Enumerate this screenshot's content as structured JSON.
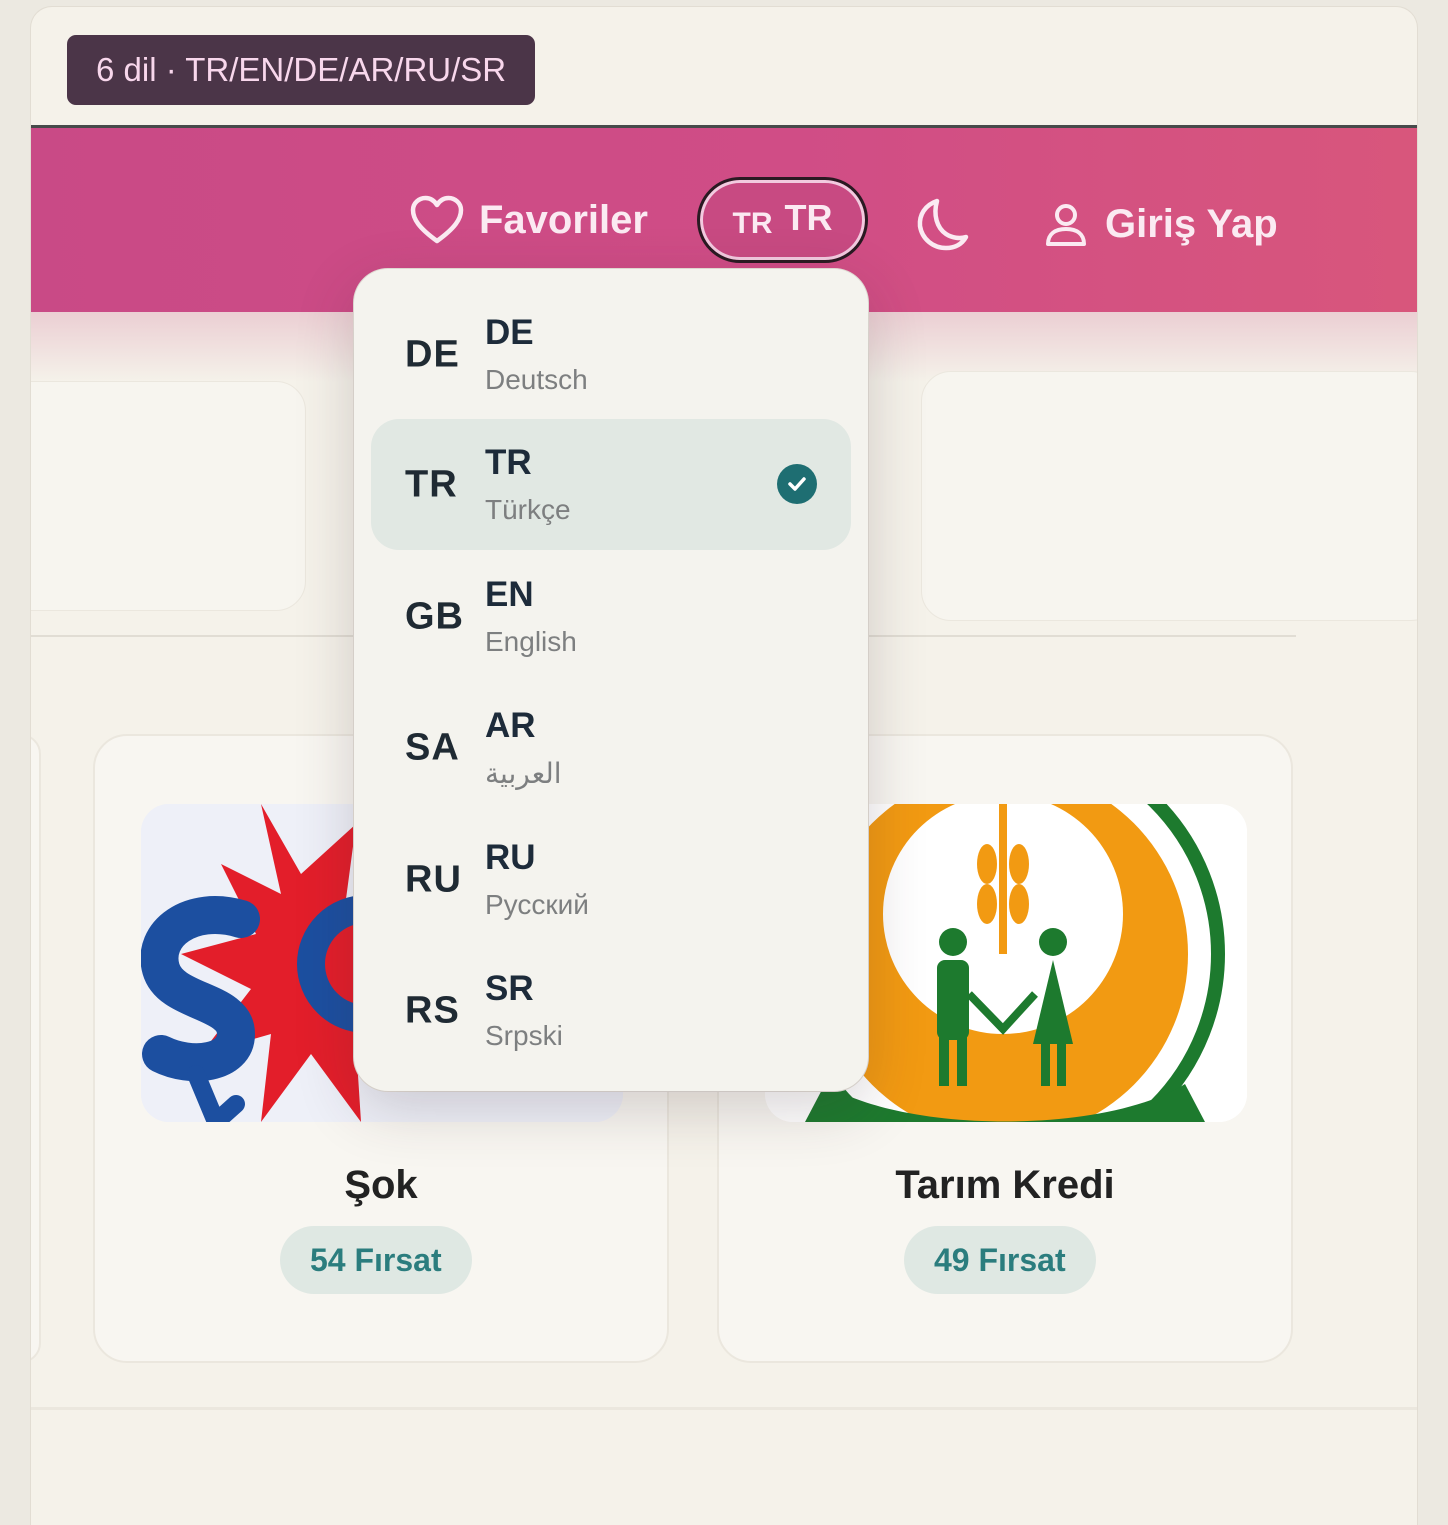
{
  "caption": "6 dil · TR/EN/DE/AR/RU/SR",
  "header": {
    "favorites_label": "Favoriler",
    "lang_flag": "TR",
    "lang_code": "TR",
    "login_label": "Giriş Yap"
  },
  "language_menu": {
    "options": [
      {
        "flag": "DE",
        "code": "DE",
        "native": "Deutsch",
        "selected": false
      },
      {
        "flag": "TR",
        "code": "TR",
        "native": "Türkçe",
        "selected": true
      },
      {
        "flag": "GB",
        "code": "EN",
        "native": "English",
        "selected": false
      },
      {
        "flag": "SA",
        "code": "AR",
        "native": "العربية",
        "selected": false
      },
      {
        "flag": "RU",
        "code": "RU",
        "native": "Русский",
        "selected": false
      },
      {
        "flag": "RS",
        "code": "SR",
        "native": "Srpski",
        "selected": false
      }
    ]
  },
  "stores": [
    {
      "name": "Şok",
      "deals": "54 Fırsat"
    },
    {
      "name": "Tarım Kredi",
      "deals": "49 Fırsat"
    }
  ],
  "colors": {
    "header": "#d04d86",
    "caption_bg": "#4b3548",
    "selected_option": "#e1e8e3",
    "check": "#1e6e72",
    "badge_text": "#2b7d7e"
  }
}
